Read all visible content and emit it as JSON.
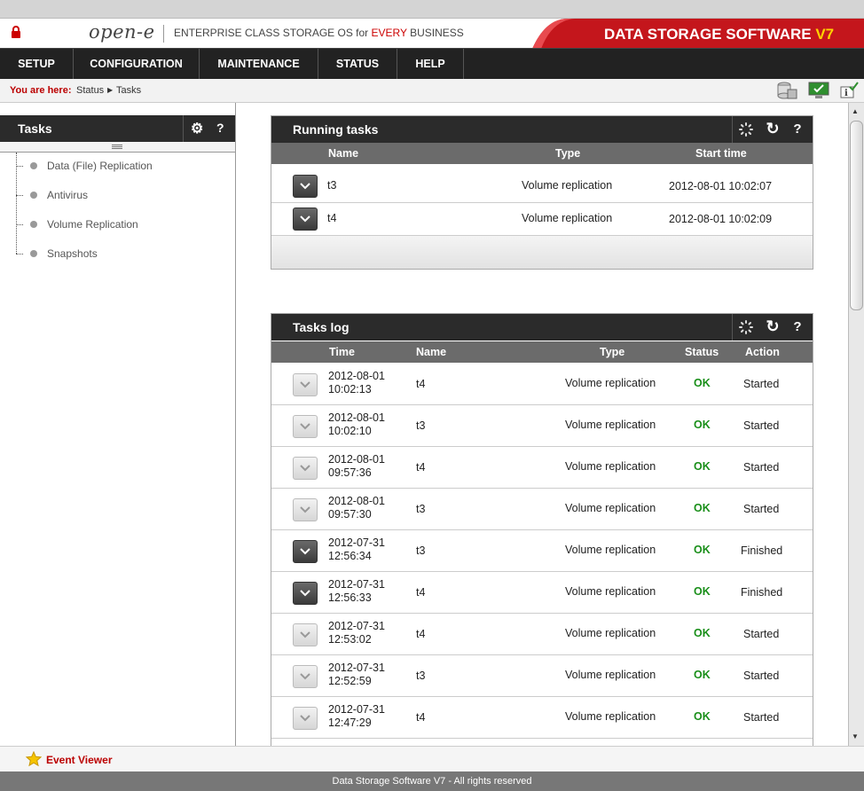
{
  "header": {
    "logo": "open-e",
    "tagline_prefix": "ENTERPRISE CLASS STORAGE OS for ",
    "tagline_highlight": "EVERY",
    "tagline_suffix": " BUSINESS",
    "brand_main": "DATA STORAGE SOFTWARE ",
    "brand_version": "V7"
  },
  "menu": {
    "setup": "SETUP",
    "configuration": "CONFIGURATION",
    "maintenance": "MAINTENANCE",
    "status": "STATUS",
    "help": "HELP"
  },
  "breadcrumb": {
    "label": "You are here:",
    "items": [
      "Status",
      "Tasks"
    ]
  },
  "sidebar": {
    "title": "Tasks",
    "items": [
      {
        "label": "Data (File) Replication"
      },
      {
        "label": "Antivirus"
      },
      {
        "label": "Volume Replication"
      },
      {
        "label": "Snapshots"
      }
    ]
  },
  "running_tasks": {
    "title": "Running tasks",
    "columns": {
      "name": "Name",
      "type": "Type",
      "start": "Start time"
    },
    "rows": [
      {
        "name": "t3",
        "type": "Volume replication",
        "start": "2012-08-01 10:02:07"
      },
      {
        "name": "t4",
        "type": "Volume replication",
        "start": "2012-08-01 10:02:09"
      }
    ]
  },
  "tasks_log": {
    "title": "Tasks log",
    "columns": {
      "time": "Time",
      "name": "Name",
      "type": "Type",
      "status": "Status",
      "action": "Action"
    },
    "rows": [
      {
        "date": "2012-08-01",
        "clock": "10:02:13",
        "name": "t4",
        "type": "Volume replication",
        "status": "OK",
        "action": "Started",
        "btn": "light"
      },
      {
        "date": "2012-08-01",
        "clock": "10:02:10",
        "name": "t3",
        "type": "Volume replication",
        "status": "OK",
        "action": "Started",
        "btn": "light"
      },
      {
        "date": "2012-08-01",
        "clock": "09:57:36",
        "name": "t4",
        "type": "Volume replication",
        "status": "OK",
        "action": "Started",
        "btn": "light"
      },
      {
        "date": "2012-08-01",
        "clock": "09:57:30",
        "name": "t3",
        "type": "Volume replication",
        "status": "OK",
        "action": "Started",
        "btn": "light"
      },
      {
        "date": "2012-07-31",
        "clock": "12:56:34",
        "name": "t3",
        "type": "Volume replication",
        "status": "OK",
        "action": "Finished",
        "btn": "dark"
      },
      {
        "date": "2012-07-31",
        "clock": "12:56:33",
        "name": "t4",
        "type": "Volume replication",
        "status": "OK",
        "action": "Finished",
        "btn": "dark"
      },
      {
        "date": "2012-07-31",
        "clock": "12:53:02",
        "name": "t4",
        "type": "Volume replication",
        "status": "OK",
        "action": "Started",
        "btn": "light"
      },
      {
        "date": "2012-07-31",
        "clock": "12:52:59",
        "name": "t3",
        "type": "Volume replication",
        "status": "OK",
        "action": "Started",
        "btn": "light"
      },
      {
        "date": "2012-07-31",
        "clock": "12:47:29",
        "name": "t4",
        "type": "Volume replication",
        "status": "OK",
        "action": "Started",
        "btn": "light"
      }
    ]
  },
  "icons": {
    "help": "?",
    "refresh": "↻"
  },
  "footer": {
    "event_viewer": "Event Viewer",
    "copyright": "Data Storage Software V7 - All rights reserved"
  },
  "colors": {
    "accent": "#cc0000",
    "ok": "#1a8f1a",
    "dark": "#2b2b2b"
  }
}
